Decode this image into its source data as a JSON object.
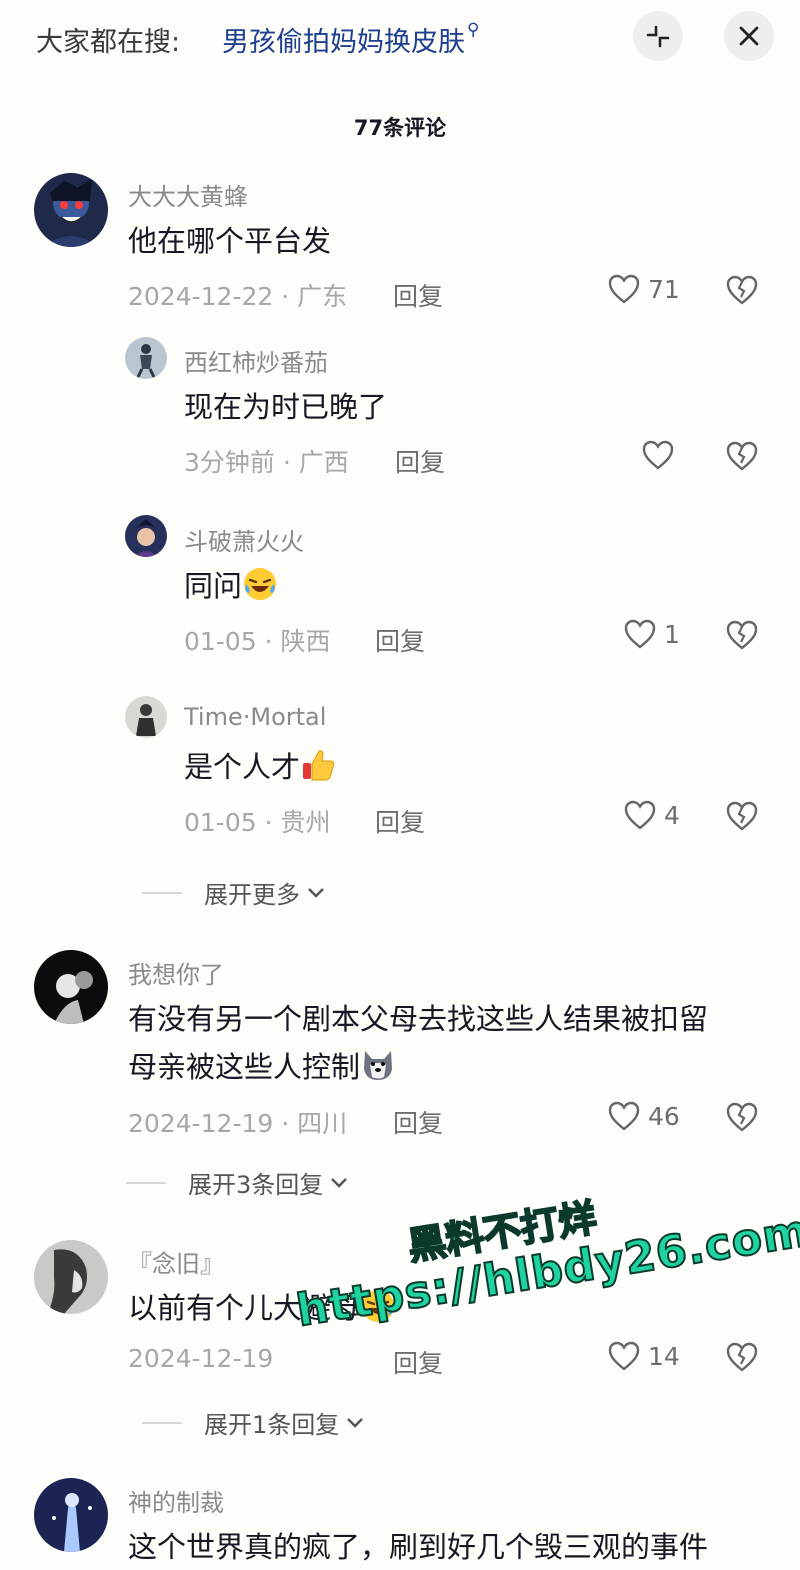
{
  "header": {
    "search_prefix": "大家都在搜:",
    "search_term": "男孩偷拍妈妈换皮肤",
    "search_icon": "search-icon",
    "shrink_icon": "shrink-icon",
    "close_icon": "close-icon"
  },
  "title": "77条评论",
  "comments": [
    {
      "user": "大大大黄蜂",
      "text": "他在哪个平台发",
      "date": "2024-12-22",
      "location": "广东",
      "reply": "回复",
      "likes": "71",
      "replies": [
        {
          "user": "西红柿炒番茄",
          "text": "现在为时已晚了",
          "date": "3分钟前",
          "location": "广西",
          "reply": "回复",
          "likes": ""
        },
        {
          "user": "斗破萧火火",
          "text": "同问",
          "emoji": "laughing-crying-emoji",
          "date": "01-05",
          "location": "陕西",
          "reply": "回复",
          "likes": "1"
        },
        {
          "user": "Time·Mortal",
          "text": "是个人才",
          "emoji": "thumbs-up-emoji",
          "date": "01-05",
          "location": "贵州",
          "reply": "回复",
          "likes": "4"
        }
      ],
      "expand_label": "展开更多"
    },
    {
      "user": "我想你了",
      "text_line1": "有没有另一个剧本父母去找这些人结果被扣留",
      "text_line2": "母亲被这些人控制",
      "emoji": "husky-emoji",
      "date": "2024-12-19",
      "location": "四川",
      "reply": "回复",
      "likes": "46",
      "expand_label": "展开3条回复"
    },
    {
      "user": "『念旧』",
      "text": "以前有个儿大避母",
      "emoji": "laughing-crying-emoji",
      "date": "2024-12-19",
      "reply": "回复",
      "likes": "14",
      "expand_label": "展开1条回复"
    },
    {
      "user": "神的制裁",
      "text": "这个世界真的疯了，刷到好几个毁三观的事件"
    }
  ],
  "watermark": {
    "line1": "黑料不打烊",
    "line2": "https://hlbdy26.com"
  },
  "colors": {
    "background": "#fdfdfa",
    "search_term": "#1e3f8f",
    "watermark": "#1fd3a0"
  }
}
